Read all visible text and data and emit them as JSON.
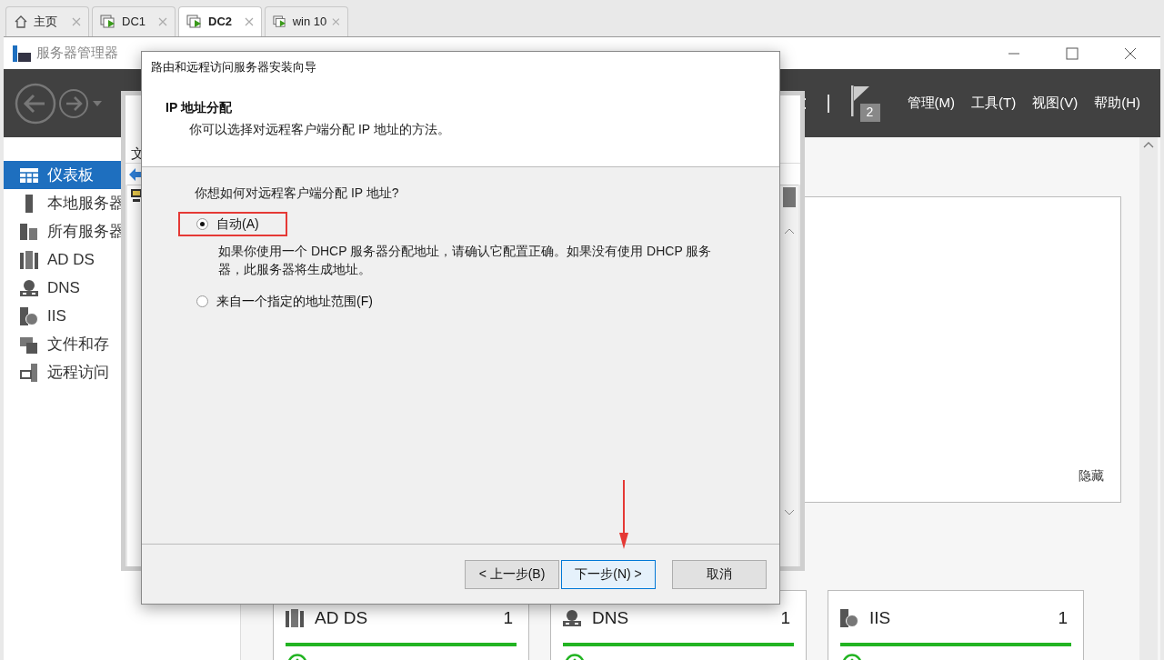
{
  "browser_tabs": [
    {
      "kind": "home",
      "label": "主页",
      "selected": false
    },
    {
      "kind": "vm",
      "label": "DC1",
      "selected": false
    },
    {
      "kind": "vm",
      "label": "DC2",
      "selected": true
    },
    {
      "kind": "vm",
      "label": "win 10",
      "selected": false
    }
  ],
  "window": {
    "title": "服务器管理器"
  },
  "notification_count": "2",
  "menu": [
    "管理(M)",
    "工具(T)",
    "视图(V)",
    "帮助(H)"
  ],
  "sidebar": {
    "items": [
      {
        "kind": "dashboard",
        "label": "仪表板",
        "selected": true
      },
      {
        "kind": "local",
        "label": "本地服务器",
        "selected": false
      },
      {
        "kind": "all",
        "label": "所有服务器",
        "selected": false
      },
      {
        "kind": "adds",
        "label": "AD DS",
        "selected": false
      },
      {
        "kind": "dns",
        "label": "DNS",
        "selected": false
      },
      {
        "kind": "iis",
        "label": "IIS",
        "selected": false
      },
      {
        "kind": "files",
        "label": "文件和存",
        "selected": false
      },
      {
        "kind": "remote",
        "label": "远程访问",
        "selected": false
      }
    ]
  },
  "background_window": {
    "menu_text": "文"
  },
  "panel": {
    "link": "隐藏"
  },
  "tiles": [
    {
      "kind": "adds",
      "title": "AD DS",
      "count": "1"
    },
    {
      "kind": "dns",
      "title": "DNS",
      "count": "1"
    },
    {
      "kind": "iis",
      "title": "IIS",
      "count": "1"
    }
  ],
  "dialog": {
    "title": "路由和远程访问服务器安装向导",
    "heading": "IP 地址分配",
    "subheading": "你可以选择对远程客户端分配 IP 地址的方法。",
    "question": "你想如何对远程客户端分配 IP 地址?",
    "options": [
      {
        "label": "自动(A)",
        "selected": true,
        "highlighted": true,
        "description": "如果你使用一个 DHCP 服务器分配地址，请确认它配置正确。如果没有使用 DHCP 服务器，此服务器将生成地址。"
      },
      {
        "label": "来自一个指定的地址范围(F)",
        "selected": false,
        "highlighted": false
      }
    ],
    "buttons": [
      {
        "label": "< 上一步(B)",
        "focused": false
      },
      {
        "label": "下一步(N) >",
        "focused": true
      },
      {
        "label": "取消",
        "focused": false
      }
    ]
  }
}
